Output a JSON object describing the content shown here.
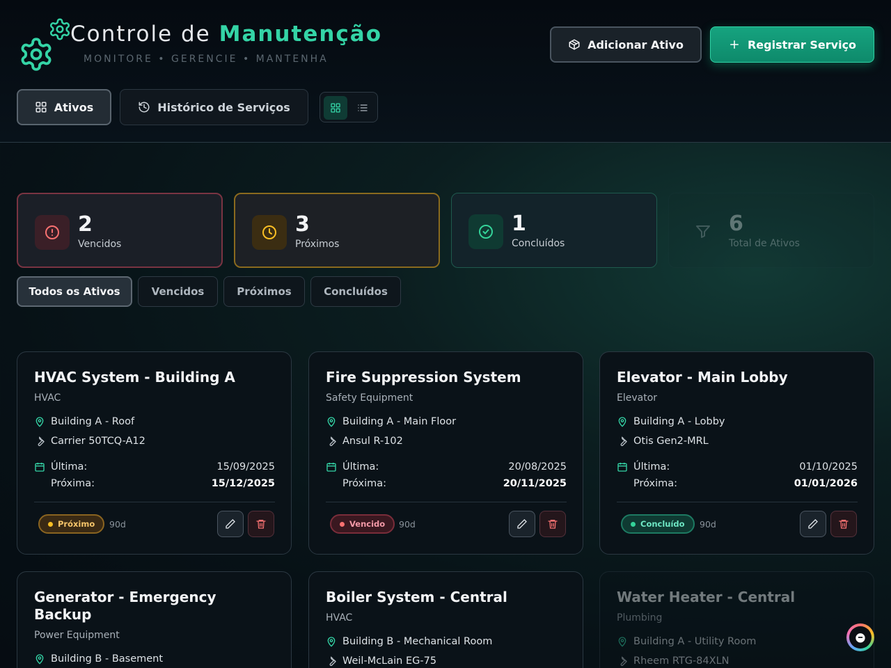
{
  "header": {
    "title_prefix": "Controle de ",
    "title_accent": "Manutenção",
    "subtitle": "MONITORE • GERENCIE • MANTENHA",
    "add_asset_label": "Adicionar Ativo",
    "register_service_label": "Registrar Serviço"
  },
  "tabs": {
    "assets": "Ativos",
    "history": "Histórico de Serviços"
  },
  "stats": {
    "overdue": {
      "value": "2",
      "label": "Vencidos"
    },
    "upcoming": {
      "value": "3",
      "label": "Próximos"
    },
    "completed": {
      "value": "1",
      "label": "Concluídos"
    },
    "total": {
      "value": "6",
      "label": "Total de Ativos"
    }
  },
  "filters": [
    "Todos os Ativos",
    "Vencidos",
    "Próximos",
    "Concluídos"
  ],
  "date_labels": {
    "last": "Última:",
    "next": "Próxima:"
  },
  "cards": [
    {
      "name": "HVAC System - Building A",
      "category": "HVAC",
      "location": "Building A - Roof",
      "model": "Carrier 50TCQ-A12",
      "last": "15/09/2025",
      "next": "15/12/2025",
      "status": "Próximo",
      "interval": "90d"
    },
    {
      "name": "Fire Suppression System",
      "category": "Safety Equipment",
      "location": "Building A - Main Floor",
      "model": "Ansul R-102",
      "last": "20/08/2025",
      "next": "20/11/2025",
      "status": "Vencido",
      "interval": "90d"
    },
    {
      "name": "Elevator - Main Lobby",
      "category": "Elevator",
      "location": "Building A - Lobby",
      "model": "Otis Gen2-MRL",
      "last": "01/10/2025",
      "next": "01/01/2026",
      "status": "Concluído",
      "interval": "90d"
    },
    {
      "name": "Generator - Emergency Backup",
      "category": "Power Equipment",
      "location": "Building B - Basement"
    },
    {
      "name": "Boiler System - Central",
      "category": "HVAC",
      "location": "Building B - Mechanical Room",
      "model": "Weil-McLain EG-75"
    },
    {
      "name": "Water Heater - Central",
      "category": "Plumbing",
      "location": "Building A - Utility Room",
      "model": "Rheem RTG-84XLN"
    }
  ],
  "colors": {
    "accent": "#34d4a6",
    "overdue": "#f87171",
    "upcoming": "#fbbf24",
    "completed": "#34d399"
  }
}
